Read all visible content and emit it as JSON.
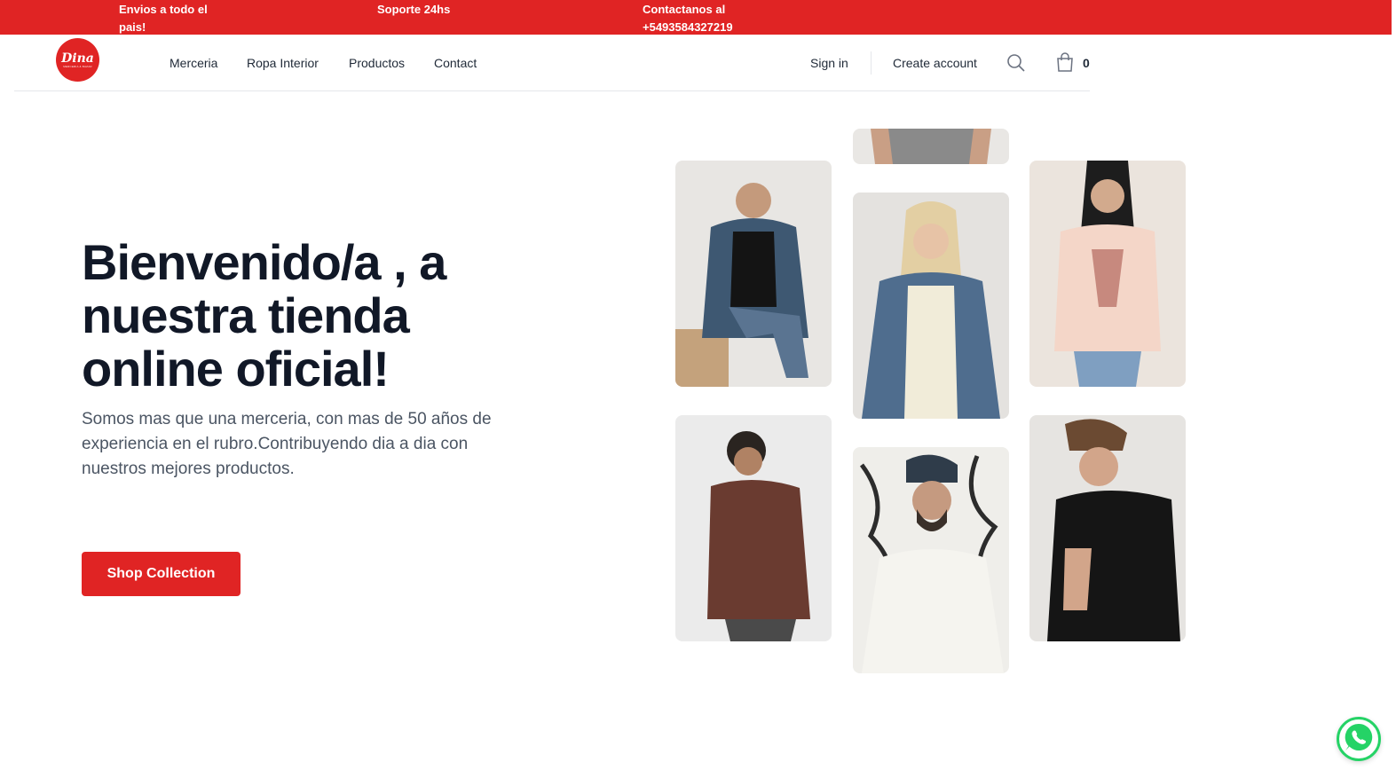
{
  "topbar": {
    "shipping": "Envios a todo el pais!",
    "support": "Soporte 24hs",
    "contact": "Contactanos al +5493584327219",
    "background": "#e02424"
  },
  "logo": {
    "brand": "Dina",
    "tagline": "MERCERIA & BAZAR",
    "icon": "dina-logo"
  },
  "nav": {
    "items": [
      "Merceria",
      "Ropa Interior",
      "Productos",
      "Contact"
    ],
    "sign_in": "Sign in",
    "create_account": "Create account",
    "search_icon": "search-icon",
    "cart_icon": "shopping-bag-icon",
    "cart_count": "0"
  },
  "hero": {
    "title": "Bienvenido/a , a nuestra tienda online oficial!",
    "text": "Somos mas que una merceria, con mas de 50 años de experiencia en el rubro.Contribuyendo dia a dia con nuestros mejores productos.",
    "cta": "Shop Collection"
  },
  "gallery": [
    "woman-denim-jacket-black-tee",
    "woman-white-tee-cropped",
    "blonde-woman-denim-jacket",
    "woman-pink-graphic-tee",
    "man-brown-tee",
    "man-beanie-white-tee",
    "man-black-tee"
  ],
  "floating": {
    "whatsapp_icon": "whatsapp-icon"
  },
  "accent_color": "#e02424"
}
